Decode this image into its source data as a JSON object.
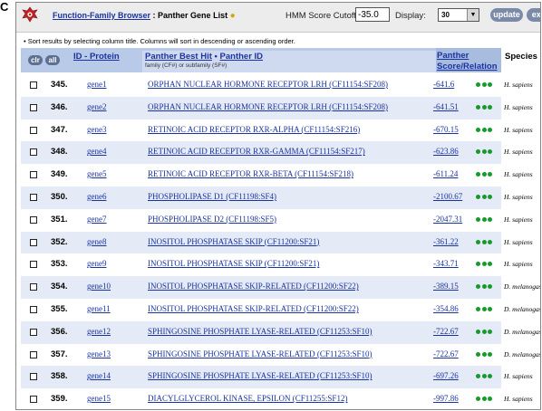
{
  "panel_letter": "C",
  "toolbar": {
    "breadcrumb_link": "Function-Family Browser",
    "breadcrumb_sep": ":",
    "breadcrumb_current": "Panther Gene List",
    "hmm_label": "HMM Score Cutoff (<):",
    "hmm_value": "-35.0",
    "display_label": "Display:",
    "display_value": "30",
    "update_label": "update",
    "export_label": "expor"
  },
  "sort_note": "• Sort results by selecting column title. Columns will sort in descending or ascending order.",
  "header": {
    "clr_label": "clr",
    "all_label": "all",
    "id_protein": "ID - Protein",
    "best_hit": "Panther Best Hit",
    "bullet": "•",
    "panther_id": "Panther ID",
    "family_sub": "family (CF#) or subfamily (SF#)",
    "score_line1": "Panther",
    "score_line2": "Score/Relation",
    "species": "Species"
  },
  "colors": {
    "header_blue": "#b9c9e8",
    "row_alt": "#e4eaf6",
    "link": "#1a33a0",
    "dot_green": "#169a2c"
  },
  "rows": [
    {
      "num": "345.",
      "gene": "gene1",
      "family": "ORPHAN NUCLEAR HORMONE RECEPTOR LRH (CF11154:SF208)",
      "score": "-641.6",
      "species": "H. sapiens"
    },
    {
      "num": "346.",
      "gene": "gene2",
      "family": "ORPHAN NUCLEAR HORMONE RECEPTOR LRH (CF11154:SF208)",
      "score": "-641.51",
      "species": "H. sapiens"
    },
    {
      "num": "347.",
      "gene": "gene3",
      "family": "RETINOIC ACID RECEPTOR RXR-ALPHA (CF11154:SF216)",
      "score": "-670.15",
      "species": "H. sapiens"
    },
    {
      "num": "348.",
      "gene": "gene4",
      "family": "RETINOIC ACID RECEPTOR RXR-GAMMA (CF11154:SF217)",
      "score": "-623.86",
      "species": "H. sapiens"
    },
    {
      "num": "349.",
      "gene": "gene5",
      "family": "RETINOIC ACID RECEPTOR RXR-BETA (CF11154:SF218)",
      "score": "-611.24",
      "species": "H. sapiens"
    },
    {
      "num": "350.",
      "gene": "gene6",
      "family": "PHOSPHOLIPASE D1 (CF11198:SF4)",
      "score": "-2100.67",
      "species": "H. sapiens"
    },
    {
      "num": "351.",
      "gene": "gene7",
      "family": "PHOSPHOLIPASE D2 (CF11198:SF5)",
      "score": "-2047.31",
      "species": "H. sapiens"
    },
    {
      "num": "352.",
      "gene": "gene8",
      "family": "INOSITOL PHOSPHATASE SKIP (CF11200:SF21)",
      "score": "-361.22",
      "species": "H. sapiens"
    },
    {
      "num": "353.",
      "gene": "gene9",
      "family": "INOSITOL PHOSPHATASE SKIP (CF11200:SF21)",
      "score": "-343.71",
      "species": "H. sapiens"
    },
    {
      "num": "354.",
      "gene": "gene10",
      "family": "INOSITOL PHOSPHATASE SKIP-RELATED (CF11200:SF22)",
      "score": "-389.15",
      "species": "D. melanogaster"
    },
    {
      "num": "355.",
      "gene": "gene11",
      "family": "INOSITOL PHOSPHATASE SKIP-RELATED (CF11200:SF22)",
      "score": "-354.86",
      "species": "D. melanogaster"
    },
    {
      "num": "356.",
      "gene": "gene12",
      "family": "SPHINGOSINE PHOSPHATE LYASE-RELATED (CF11253:SF10)",
      "score": "-722.67",
      "species": "D. melanogaster"
    },
    {
      "num": "357.",
      "gene": "gene13",
      "family": "SPHINGOSINE PHOSPHATE LYASE-RELATED (CF11253:SF10)",
      "score": "-722.67",
      "species": "D. melanogaster"
    },
    {
      "num": "358.",
      "gene": "gene14",
      "family": "SPHINGOSINE PHOSPHATE LYASE-RELATED (CF11253:SF10)",
      "score": "-697.26",
      "species": "H. sapiens"
    },
    {
      "num": "359.",
      "gene": "gene15",
      "family": "DIACYLGLYCEROL KINASE, EPSILON (CF11255:SF12)",
      "score": "-997.86",
      "species": "H. sapiens"
    }
  ]
}
